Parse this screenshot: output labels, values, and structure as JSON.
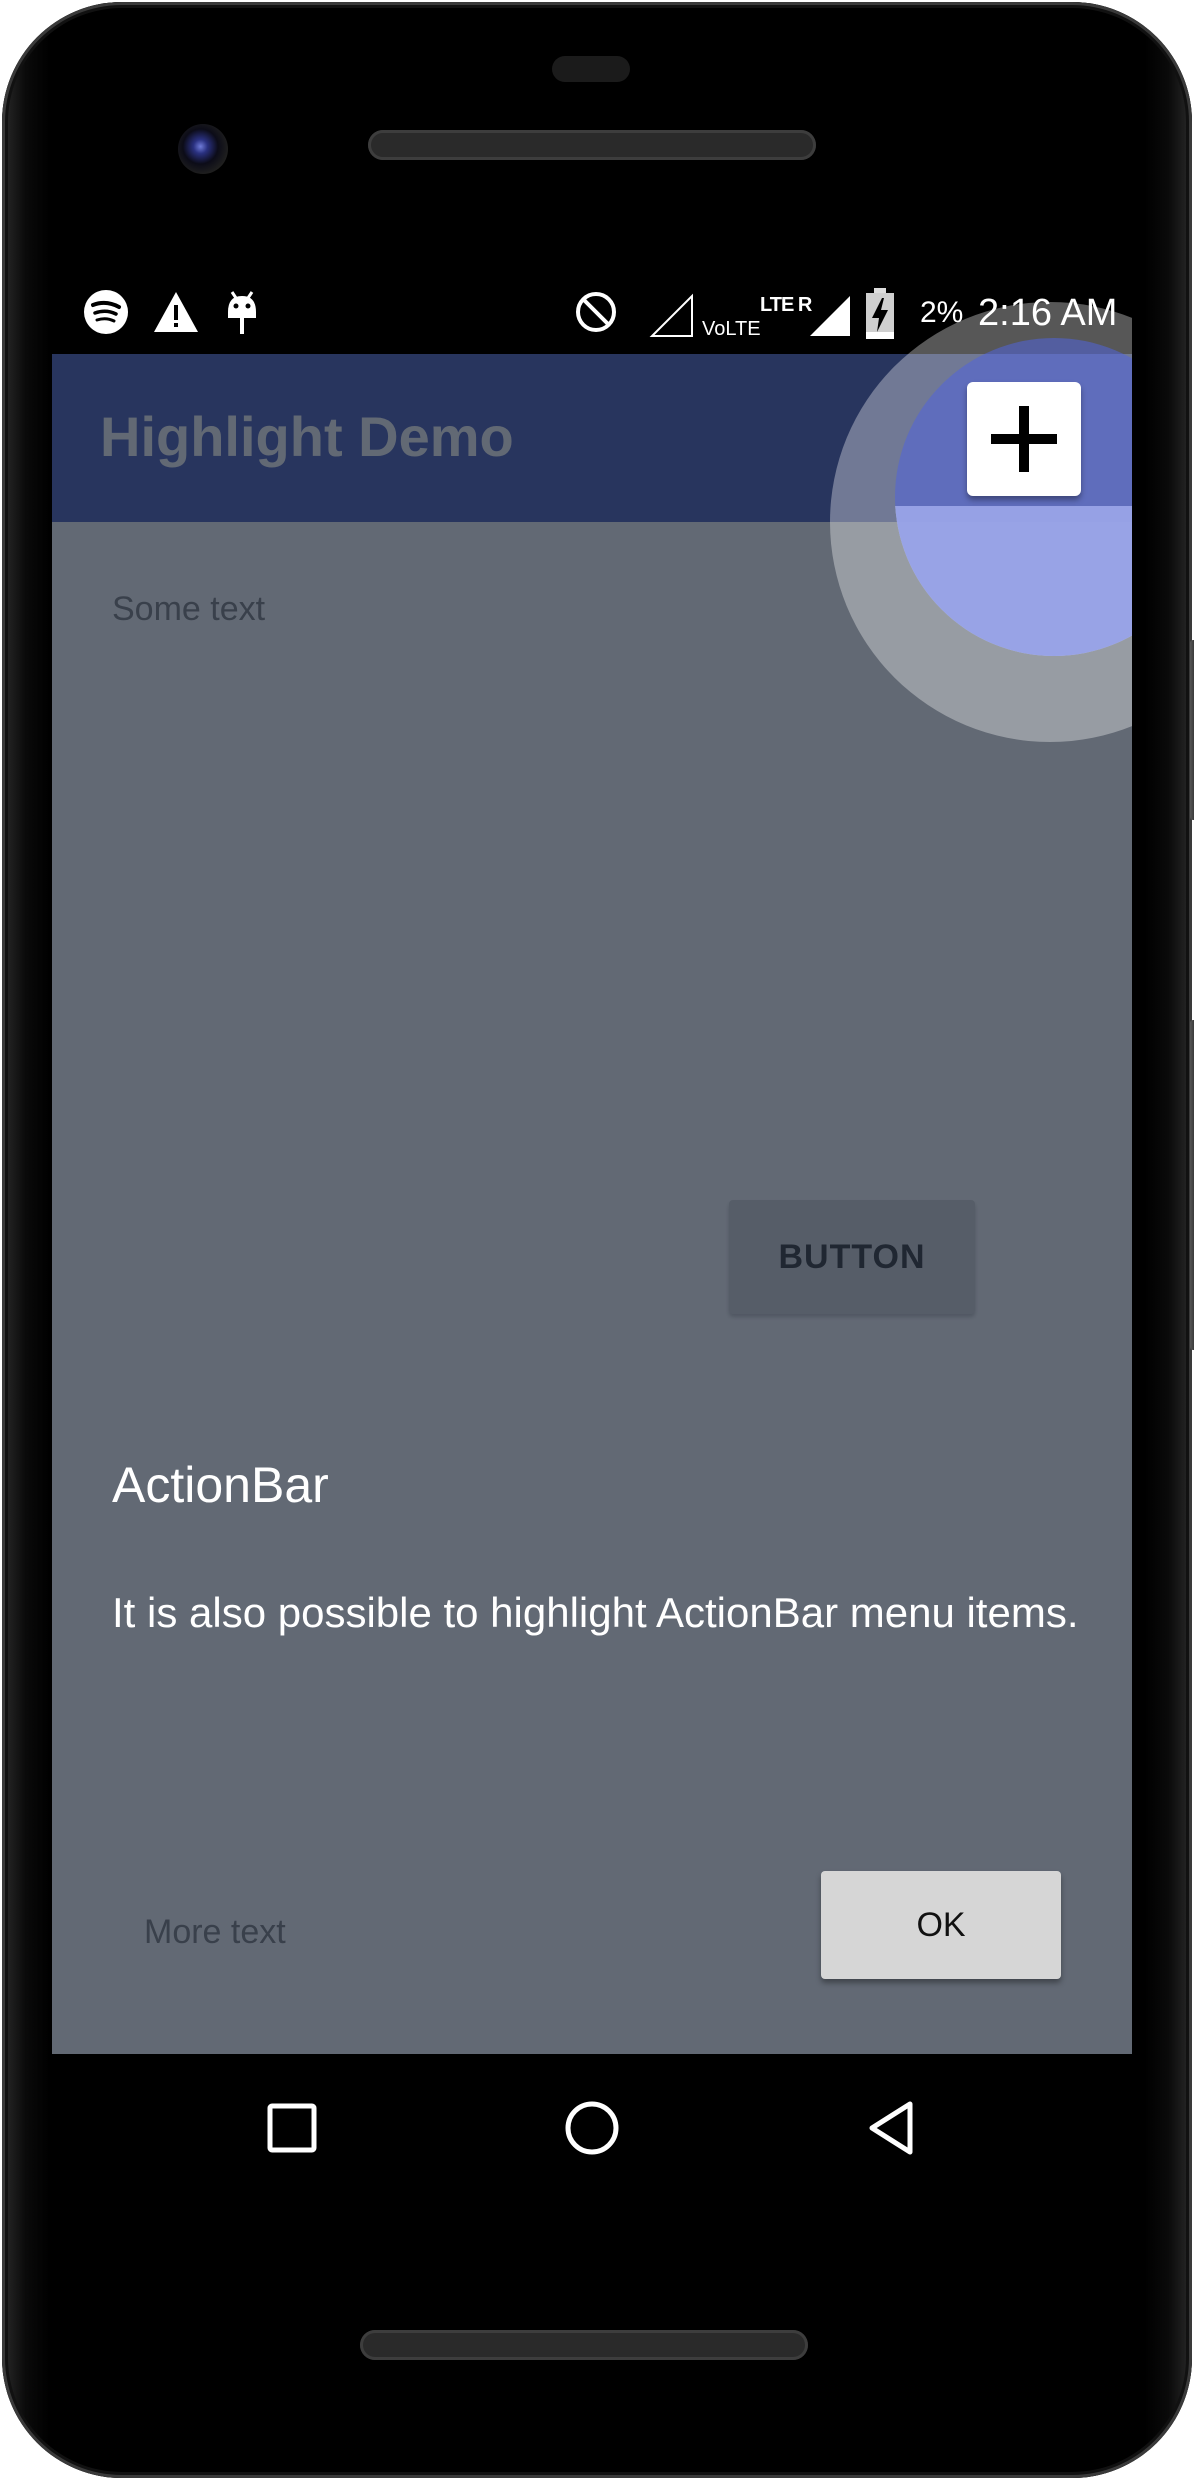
{
  "status_bar": {
    "battery_percent": "2%",
    "time": "2:16 AM",
    "network_label": "VoLTE",
    "lte_label": "LTE R",
    "icons": [
      "spotify-icon",
      "warning-icon",
      "android-debug-icon",
      "do-not-disturb-icon",
      "signal-empty-icon",
      "signal-full-icon",
      "battery-charging-icon"
    ]
  },
  "app": {
    "title": "Highlight Demo",
    "add_action_icon": "plus-icon",
    "some_text": "Some text",
    "button_label": "BUTTON",
    "more_text": "More text",
    "primary_color": "#3f51b5"
  },
  "highlight": {
    "title": "ActionBar",
    "description": "It is also possible to highlight ActionBar menu items.",
    "ok_label": "OK",
    "overlay_color": "#1f2939"
  },
  "nav_bar": {
    "icons": [
      "recents-icon",
      "home-icon",
      "back-icon"
    ]
  }
}
